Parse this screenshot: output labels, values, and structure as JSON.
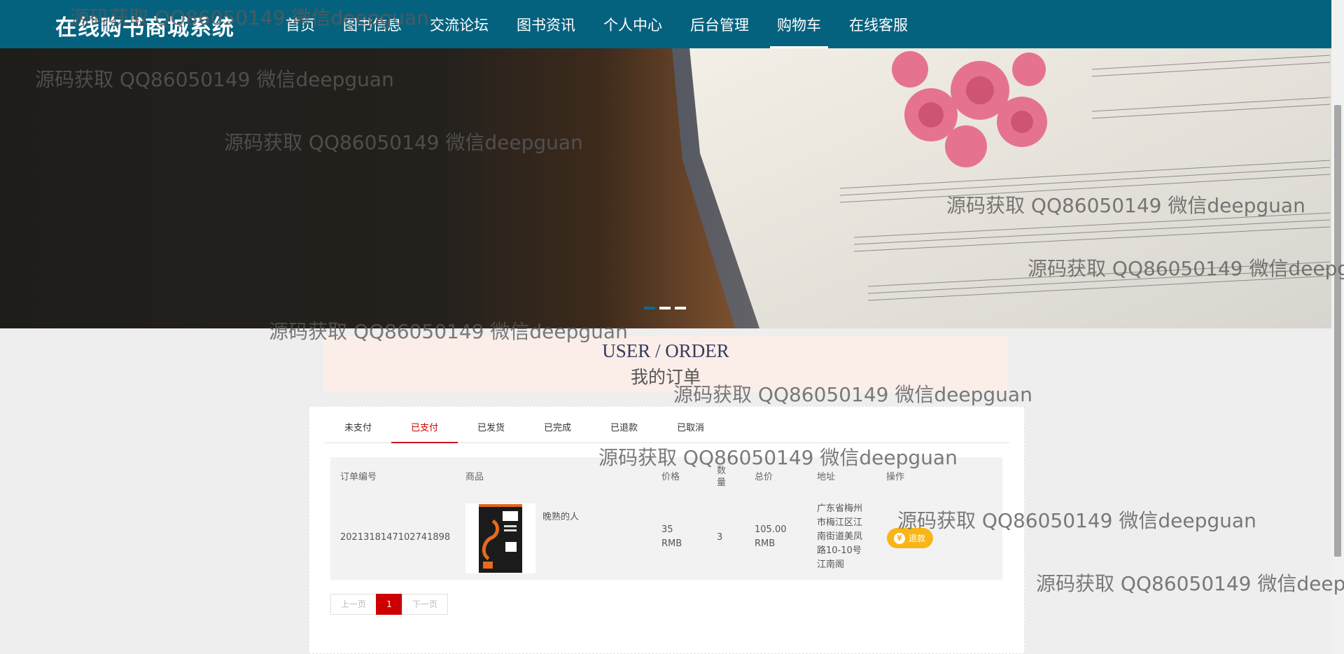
{
  "header": {
    "brand": "在线购书商城系统",
    "nav": [
      {
        "label": "首页"
      },
      {
        "label": "图书信息"
      },
      {
        "label": "交流论坛"
      },
      {
        "label": "图书资讯"
      },
      {
        "label": "个人中心"
      },
      {
        "label": "后台管理"
      },
      {
        "label": "购物车"
      },
      {
        "label": "在线客服"
      }
    ]
  },
  "banner": {
    "slide_count": 3,
    "active_slide": 1
  },
  "section": {
    "title_en": "USER / ORDER",
    "title_zh": "我的订单"
  },
  "tabs": [
    "未支付",
    "已支付",
    "已发货",
    "已完成",
    "已退款",
    "已取消"
  ],
  "active_tab": "已支付",
  "table": {
    "headers": {
      "order_no": "订单编号",
      "product": "商品",
      "price": "价格",
      "quantity": "数量",
      "total": "总价",
      "address": "地址",
      "action": "操作"
    },
    "rows": [
      {
        "order_no": "2021318147102741898",
        "product_name": "晚熟的人",
        "price": "35 RMB",
        "quantity": "3",
        "total": "105.00 RMB",
        "address": "广东省梅州市梅江区江南街道美凤路10-10号江南阁",
        "action_icon": "¥",
        "action_label": "退款"
      }
    ]
  },
  "pager": {
    "prev": "上一页",
    "current": "1",
    "next": "下一页"
  },
  "watermark": "源码获取 QQ86050149 微信deepguan",
  "colors": {
    "header_bg": "#05627f",
    "active_red": "#c81623",
    "refund_btn": "#f8b517",
    "title_bg": "#fbeee8"
  }
}
